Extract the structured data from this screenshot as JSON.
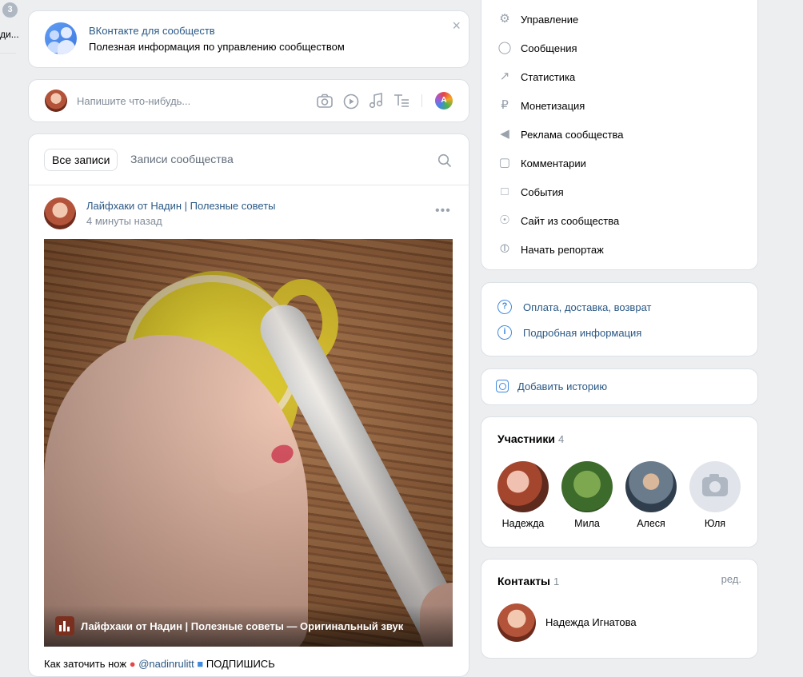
{
  "left_rail": {
    "badge": "3",
    "text": "ди..."
  },
  "info_card": {
    "title": "ВКонтакте для сообществ",
    "subtitle": "Полезная информация по управлению сообществом",
    "close": "×"
  },
  "compose": {
    "placeholder": "Напишите что-нибудь...",
    "ai_badge": "A"
  },
  "feed": {
    "tabs": [
      {
        "label": "Все записи",
        "active": true
      },
      {
        "label": "Записи сообщества",
        "active": false
      }
    ],
    "post": {
      "author": "Лайфхаки от Надин | Полезные советы",
      "time": "4 минуты назад",
      "more": "•••",
      "audio": "Лайфхаки от Надин | Полезные советы — Оригинальный звук",
      "text_start": "Как заточить нож",
      "mention": "@nadinrulitt",
      "text_end": "ПОДПИШИСЬ"
    }
  },
  "manage_menu": [
    {
      "label": "Управление",
      "icon": "gear-icon"
    },
    {
      "label": "Сообщения",
      "icon": "message-icon"
    },
    {
      "label": "Статистика",
      "icon": "chart-icon"
    },
    {
      "label": "Монетизация",
      "icon": "ruble-icon"
    },
    {
      "label": "Реклама сообщества",
      "icon": "megaphone-icon"
    },
    {
      "label": "Комментарии",
      "icon": "comment-icon"
    },
    {
      "label": "События",
      "icon": "event-icon"
    },
    {
      "label": "Сайт из сообщества",
      "icon": "globe-icon"
    },
    {
      "label": "Начать репортаж",
      "icon": "broadcast-icon"
    }
  ],
  "info_links": [
    {
      "label": "Оплата, доставка, возврат",
      "icon": "question-icon"
    },
    {
      "label": "Подробная информация",
      "icon": "info-icon"
    }
  ],
  "story": {
    "label": "Добавить историю"
  },
  "members": {
    "title": "Участники",
    "count": "4",
    "list": [
      {
        "name": "Надежда"
      },
      {
        "name": "Мила"
      },
      {
        "name": "Алеся"
      },
      {
        "name": "Юля"
      }
    ]
  },
  "contacts": {
    "title": "Контакты",
    "count": "1",
    "edit": "ред.",
    "list": [
      {
        "name": "Надежда Игнатова"
      }
    ]
  }
}
